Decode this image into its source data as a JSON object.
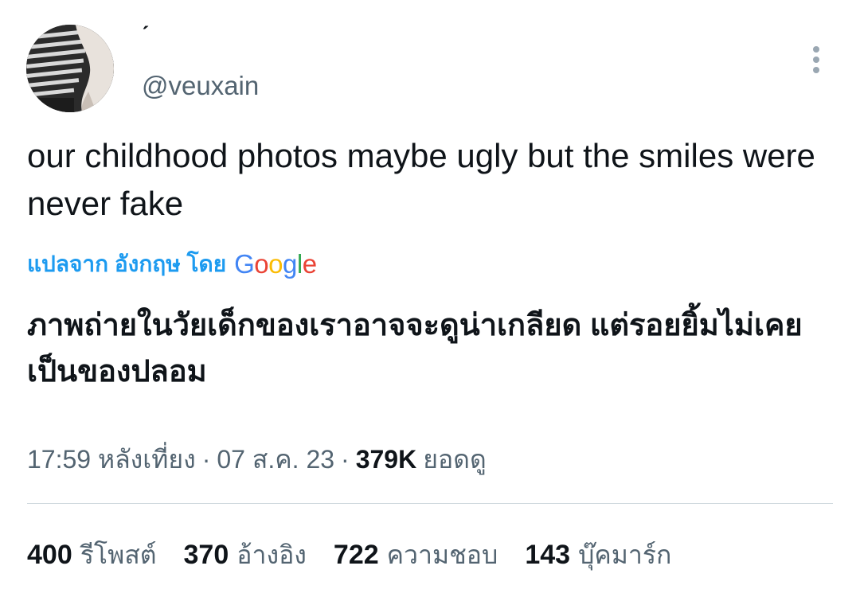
{
  "author": {
    "display_name": "ˊ",
    "handle": "@veuxain"
  },
  "tweet": {
    "text": "our childhood photos maybe ugly but the smiles were never fake",
    "translate_label": "แปลจาก อังกฤษ โดย",
    "translator_brand": {
      "letters": [
        "G",
        "o",
        "o",
        "g",
        "l",
        "e"
      ],
      "colors": [
        "#4285f4",
        "#ea4335",
        "#fbbc05",
        "#4285f4",
        "#34a853",
        "#ea4335"
      ]
    },
    "translated_text": "ภาพถ่ายในวัยเด็กของเราอาจจะดูน่าเกลียด แต่รอยยิ้มไม่เคยเป็นของปลอม"
  },
  "meta": {
    "time": "17:59 หลังเที่ยง",
    "separator": "·",
    "date": "07 ส.ค. 23",
    "views_count": "379K",
    "views_label": "ยอดดู"
  },
  "stats": {
    "retweets": {
      "count": "400",
      "label": "รีโพสต์"
    },
    "quotes": {
      "count": "370",
      "label": "อ้างอิง"
    },
    "likes": {
      "count": "722",
      "label": "ความชอบ"
    },
    "bookmarks": {
      "count": "143",
      "label": "บุ๊คมาร์ก"
    }
  },
  "colors": {
    "link": "#1d9bf0",
    "text_primary": "#0f1419",
    "text_secondary": "#536471",
    "divider": "#cfd9de"
  },
  "icons": {
    "more": "more-vertical-icon"
  }
}
